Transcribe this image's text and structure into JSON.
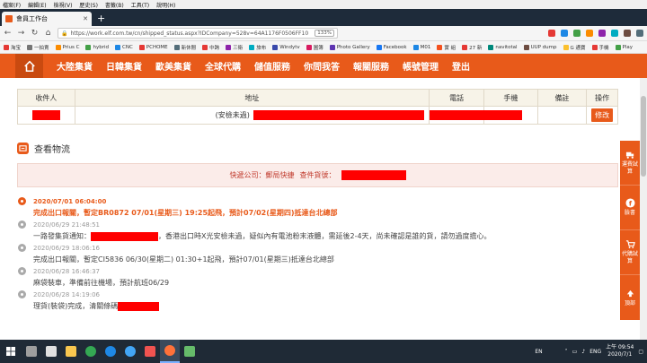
{
  "browser": {
    "menu": [
      "檔案(F)",
      "編輯(E)",
      "檢視(V)",
      "歷史(S)",
      "書籤(B)",
      "工具(T)",
      "說明(H)"
    ],
    "tab_title": "會員工作台",
    "new_tab": "+",
    "url": "https://work.elf.com.tw/cn/shipped_status.aspx?IDCompany=528v=64A1176F0506FF10",
    "zoom": "133%",
    "bookmarks": [
      "淘宝",
      "一拍賣",
      "Prius C",
      "hybrid",
      "CNC",
      "PCHOME",
      "新休閒",
      "中跨",
      "三衛",
      "旅布",
      "Windytv",
      "圖簿",
      "Photo Gallery",
      "Facebook",
      "M01",
      "實 組",
      "27 新",
      "navitotal",
      "UUP dump",
      "G 通寶",
      "手機",
      "Play"
    ]
  },
  "site_nav": {
    "items": [
      "大陸集貨",
      "日韓集貨",
      "歐美集貨",
      "全球代購",
      "儲值服務",
      "你問我答",
      "報關服務",
      "帳號管理",
      "登出"
    ]
  },
  "receiver_table": {
    "headers": [
      "收件人",
      "地址",
      "電話",
      "手機",
      "備註",
      "操作"
    ],
    "address_prefix": "(安檢未過)",
    "edit_label": "修改"
  },
  "logistics": {
    "title": "查看物流",
    "courier_label": "快遞公司：郵局快捷",
    "tracking_label": "查件貨號："
  },
  "events": [
    {
      "time": "2020/07/01 06:04:00",
      "desc": "完成出口報關，暫定BR0872 07/01(星期三) 19:25起飛，預計07/02(星期四)抵達台北總部"
    },
    {
      "time": "2020/06/29 21:48:51",
      "desc_a": "一路發集貨通知：",
      "desc_b": "，香港出口時X光安檢未過，疑似內有電池粉末液體，需延後2-4天，尚未確認是誰的貨，請勿過度擔心。"
    },
    {
      "time": "2020/06/29 18:06:16",
      "desc": "完成出口報關，暫定CI5836 06/30(星期二) 01:30+1起飛，預計07/01(星期三)抵達台北總部"
    },
    {
      "time": "2020/06/28 16:46:37",
      "desc": "麻袋裝車，準備前往機場，預計航班06/29"
    },
    {
      "time": "2020/06/28 14:19:06",
      "desc": "理貨(裝袋)完成，清關條碼"
    }
  ],
  "sidebar": [
    {
      "label": "運費試算"
    },
    {
      "label": "臉書"
    },
    {
      "label": "代購試算"
    },
    {
      "label": "頂部"
    }
  ],
  "taskbar": {
    "lang": "EN",
    "ime": "ENG",
    "time": "上午 09:54",
    "date": "2020/7/1"
  },
  "colors": {
    "brand": "#e85a1a",
    "redaction": "#ff0000"
  }
}
